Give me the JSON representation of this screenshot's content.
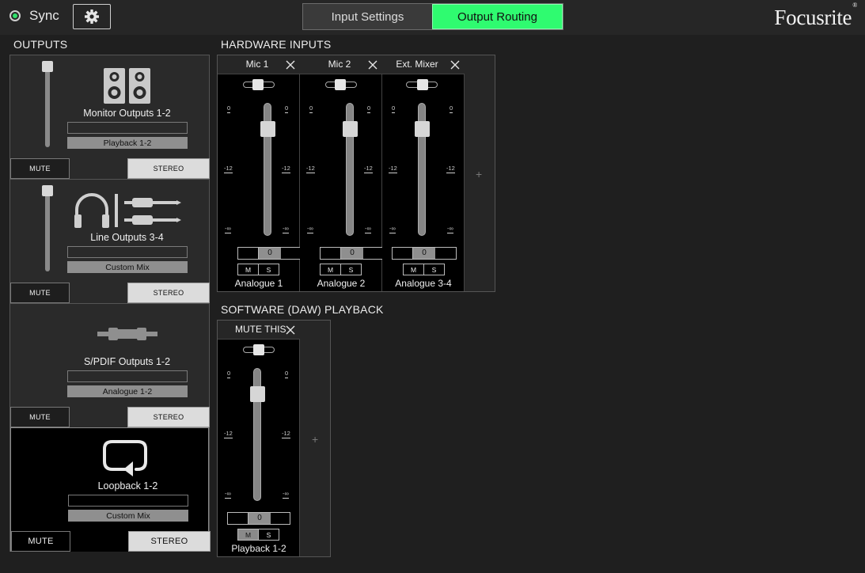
{
  "topbar": {
    "sync_label": "Sync",
    "tabs": [
      {
        "label": "Input Settings",
        "active": false
      },
      {
        "label": "Output Routing",
        "active": true
      }
    ],
    "logo_text": "Focusrite",
    "logo_mark": "®"
  },
  "colors": {
    "accent": "#2ffb70",
    "background": "#1f1f1f",
    "panel": "#2a2a2a",
    "strip": "#000000"
  },
  "sections": {
    "outputs": "OUTPUTS",
    "hardware_inputs": "HARDWARE INPUTS",
    "software_playback": "SOFTWARE (DAW) PLAYBACK"
  },
  "outputs": [
    {
      "name": "Monitor Outputs 1-2",
      "source": "Playback 1-2",
      "mute": "MUTE",
      "stereo": "STEREO",
      "icon": "speakers-icon",
      "has_slider": true,
      "selected": false
    },
    {
      "name": "Line Outputs 3-4",
      "source": "Custom Mix",
      "mute": "MUTE",
      "stereo": "STEREO",
      "icon": "headphones-jack-icon",
      "has_slider": true,
      "selected": false
    },
    {
      "name": "S/PDIF Outputs 1-2",
      "source": "Analogue 1-2",
      "mute": "MUTE",
      "stereo": "STEREO",
      "icon": "spdif-cable-icon",
      "has_slider": false,
      "selected": false
    },
    {
      "name": "Loopback 1-2",
      "source": "Custom Mix",
      "mute": "MUTE",
      "stereo": "STEREO",
      "icon": "loopback-icon",
      "has_slider": false,
      "selected": true
    }
  ],
  "scale": {
    "top": "0",
    "mid": "-12",
    "bottom": "-∞"
  },
  "hardware_strips": [
    {
      "title": "Mic 1",
      "label": "Analogue 1",
      "gain": "0",
      "m": "M",
      "s": "S",
      "m_on": false
    },
    {
      "title": "Mic 2",
      "label": "Analogue 2",
      "gain": "0",
      "m": "M",
      "s": "S",
      "m_on": false
    },
    {
      "title": "Ext. Mixer",
      "label": "Analogue 3-4",
      "gain": "0",
      "m": "M",
      "s": "S",
      "m_on": false
    }
  ],
  "software_strips": [
    {
      "title": "MUTE THIS",
      "label": "Playback 1-2",
      "gain": "0",
      "m": "M",
      "s": "S",
      "m_on": true
    }
  ],
  "add_symbol": "+"
}
